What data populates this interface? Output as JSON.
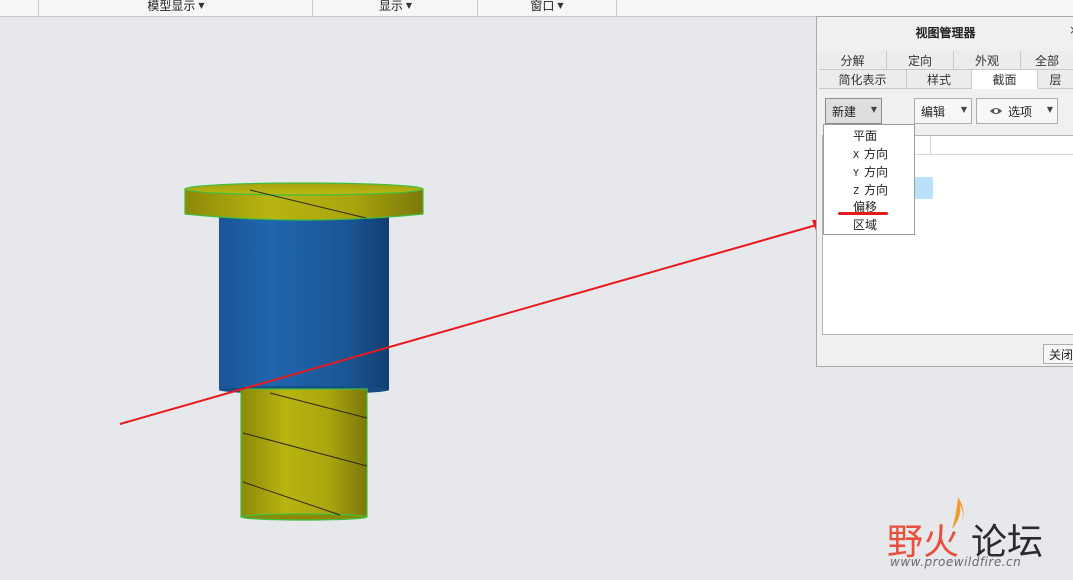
{
  "toolbar": {
    "groups": [
      {
        "label": "模型显示"
      },
      {
        "label": "显示"
      },
      {
        "label": "窗口"
      }
    ]
  },
  "view_manager": {
    "title": "视图管理器",
    "close_x": "×",
    "tabs_row1": [
      "分解",
      "定向",
      "外观",
      "全部"
    ],
    "tabs_row2": [
      "简化表示",
      "样式",
      "截面",
      "层"
    ],
    "active_tab": "截面",
    "new_button": "新建",
    "edit_button": "编辑",
    "options_button": "选项",
    "close_button": "关闭"
  },
  "new_menu": {
    "items": [
      {
        "label": "平面",
        "axis": ""
      },
      {
        "label": "方向",
        "axis": "X"
      },
      {
        "label": "方向",
        "axis": "Y"
      },
      {
        "label": "方向",
        "axis": "Z"
      },
      {
        "label": "偏移",
        "axis": ""
      },
      {
        "label": "区域",
        "axis": ""
      }
    ],
    "highlighted": "偏移"
  },
  "annotation": {
    "arrow_color": "#e8191c"
  },
  "colors": {
    "thread_yellow": "#b5b20f",
    "body_blue": "#1e5fa3",
    "viewport_bg": "#e6e8ec",
    "selection_blue": "#b9e1f9"
  },
  "watermark": {
    "cn_red": "野火",
    "cn_dark": "论坛",
    "url": "www.proewildfire.cn"
  }
}
